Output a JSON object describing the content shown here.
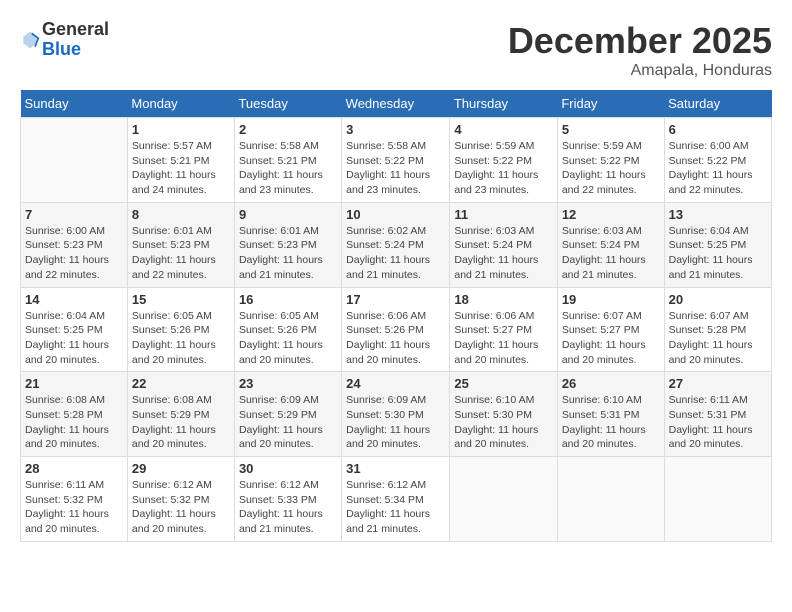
{
  "header": {
    "logo_general": "General",
    "logo_blue": "Blue",
    "month_title": "December 2025",
    "location": "Amapala, Honduras"
  },
  "days_of_week": [
    "Sunday",
    "Monday",
    "Tuesday",
    "Wednesday",
    "Thursday",
    "Friday",
    "Saturday"
  ],
  "weeks": [
    [
      {
        "day": "",
        "sunrise": "",
        "sunset": "",
        "daylight": ""
      },
      {
        "day": "1",
        "sunrise": "Sunrise: 5:57 AM",
        "sunset": "Sunset: 5:21 PM",
        "daylight": "Daylight: 11 hours and 24 minutes."
      },
      {
        "day": "2",
        "sunrise": "Sunrise: 5:58 AM",
        "sunset": "Sunset: 5:21 PM",
        "daylight": "Daylight: 11 hours and 23 minutes."
      },
      {
        "day": "3",
        "sunrise": "Sunrise: 5:58 AM",
        "sunset": "Sunset: 5:22 PM",
        "daylight": "Daylight: 11 hours and 23 minutes."
      },
      {
        "day": "4",
        "sunrise": "Sunrise: 5:59 AM",
        "sunset": "Sunset: 5:22 PM",
        "daylight": "Daylight: 11 hours and 23 minutes."
      },
      {
        "day": "5",
        "sunrise": "Sunrise: 5:59 AM",
        "sunset": "Sunset: 5:22 PM",
        "daylight": "Daylight: 11 hours and 22 minutes."
      },
      {
        "day": "6",
        "sunrise": "Sunrise: 6:00 AM",
        "sunset": "Sunset: 5:22 PM",
        "daylight": "Daylight: 11 hours and 22 minutes."
      }
    ],
    [
      {
        "day": "7",
        "sunrise": "Sunrise: 6:00 AM",
        "sunset": "Sunset: 5:23 PM",
        "daylight": "Daylight: 11 hours and 22 minutes."
      },
      {
        "day": "8",
        "sunrise": "Sunrise: 6:01 AM",
        "sunset": "Sunset: 5:23 PM",
        "daylight": "Daylight: 11 hours and 22 minutes."
      },
      {
        "day": "9",
        "sunrise": "Sunrise: 6:01 AM",
        "sunset": "Sunset: 5:23 PM",
        "daylight": "Daylight: 11 hours and 21 minutes."
      },
      {
        "day": "10",
        "sunrise": "Sunrise: 6:02 AM",
        "sunset": "Sunset: 5:24 PM",
        "daylight": "Daylight: 11 hours and 21 minutes."
      },
      {
        "day": "11",
        "sunrise": "Sunrise: 6:03 AM",
        "sunset": "Sunset: 5:24 PM",
        "daylight": "Daylight: 11 hours and 21 minutes."
      },
      {
        "day": "12",
        "sunrise": "Sunrise: 6:03 AM",
        "sunset": "Sunset: 5:24 PM",
        "daylight": "Daylight: 11 hours and 21 minutes."
      },
      {
        "day": "13",
        "sunrise": "Sunrise: 6:04 AM",
        "sunset": "Sunset: 5:25 PM",
        "daylight": "Daylight: 11 hours and 21 minutes."
      }
    ],
    [
      {
        "day": "14",
        "sunrise": "Sunrise: 6:04 AM",
        "sunset": "Sunset: 5:25 PM",
        "daylight": "Daylight: 11 hours and 20 minutes."
      },
      {
        "day": "15",
        "sunrise": "Sunrise: 6:05 AM",
        "sunset": "Sunset: 5:26 PM",
        "daylight": "Daylight: 11 hours and 20 minutes."
      },
      {
        "day": "16",
        "sunrise": "Sunrise: 6:05 AM",
        "sunset": "Sunset: 5:26 PM",
        "daylight": "Daylight: 11 hours and 20 minutes."
      },
      {
        "day": "17",
        "sunrise": "Sunrise: 6:06 AM",
        "sunset": "Sunset: 5:26 PM",
        "daylight": "Daylight: 11 hours and 20 minutes."
      },
      {
        "day": "18",
        "sunrise": "Sunrise: 6:06 AM",
        "sunset": "Sunset: 5:27 PM",
        "daylight": "Daylight: 11 hours and 20 minutes."
      },
      {
        "day": "19",
        "sunrise": "Sunrise: 6:07 AM",
        "sunset": "Sunset: 5:27 PM",
        "daylight": "Daylight: 11 hours and 20 minutes."
      },
      {
        "day": "20",
        "sunrise": "Sunrise: 6:07 AM",
        "sunset": "Sunset: 5:28 PM",
        "daylight": "Daylight: 11 hours and 20 minutes."
      }
    ],
    [
      {
        "day": "21",
        "sunrise": "Sunrise: 6:08 AM",
        "sunset": "Sunset: 5:28 PM",
        "daylight": "Daylight: 11 hours and 20 minutes."
      },
      {
        "day": "22",
        "sunrise": "Sunrise: 6:08 AM",
        "sunset": "Sunset: 5:29 PM",
        "daylight": "Daylight: 11 hours and 20 minutes."
      },
      {
        "day": "23",
        "sunrise": "Sunrise: 6:09 AM",
        "sunset": "Sunset: 5:29 PM",
        "daylight": "Daylight: 11 hours and 20 minutes."
      },
      {
        "day": "24",
        "sunrise": "Sunrise: 6:09 AM",
        "sunset": "Sunset: 5:30 PM",
        "daylight": "Daylight: 11 hours and 20 minutes."
      },
      {
        "day": "25",
        "sunrise": "Sunrise: 6:10 AM",
        "sunset": "Sunset: 5:30 PM",
        "daylight": "Daylight: 11 hours and 20 minutes."
      },
      {
        "day": "26",
        "sunrise": "Sunrise: 6:10 AM",
        "sunset": "Sunset: 5:31 PM",
        "daylight": "Daylight: 11 hours and 20 minutes."
      },
      {
        "day": "27",
        "sunrise": "Sunrise: 6:11 AM",
        "sunset": "Sunset: 5:31 PM",
        "daylight": "Daylight: 11 hours and 20 minutes."
      }
    ],
    [
      {
        "day": "28",
        "sunrise": "Sunrise: 6:11 AM",
        "sunset": "Sunset: 5:32 PM",
        "daylight": "Daylight: 11 hours and 20 minutes."
      },
      {
        "day": "29",
        "sunrise": "Sunrise: 6:12 AM",
        "sunset": "Sunset: 5:32 PM",
        "daylight": "Daylight: 11 hours and 20 minutes."
      },
      {
        "day": "30",
        "sunrise": "Sunrise: 6:12 AM",
        "sunset": "Sunset: 5:33 PM",
        "daylight": "Daylight: 11 hours and 21 minutes."
      },
      {
        "day": "31",
        "sunrise": "Sunrise: 6:12 AM",
        "sunset": "Sunset: 5:34 PM",
        "daylight": "Daylight: 11 hours and 21 minutes."
      },
      {
        "day": "",
        "sunrise": "",
        "sunset": "",
        "daylight": ""
      },
      {
        "day": "",
        "sunrise": "",
        "sunset": "",
        "daylight": ""
      },
      {
        "day": "",
        "sunrise": "",
        "sunset": "",
        "daylight": ""
      }
    ]
  ]
}
